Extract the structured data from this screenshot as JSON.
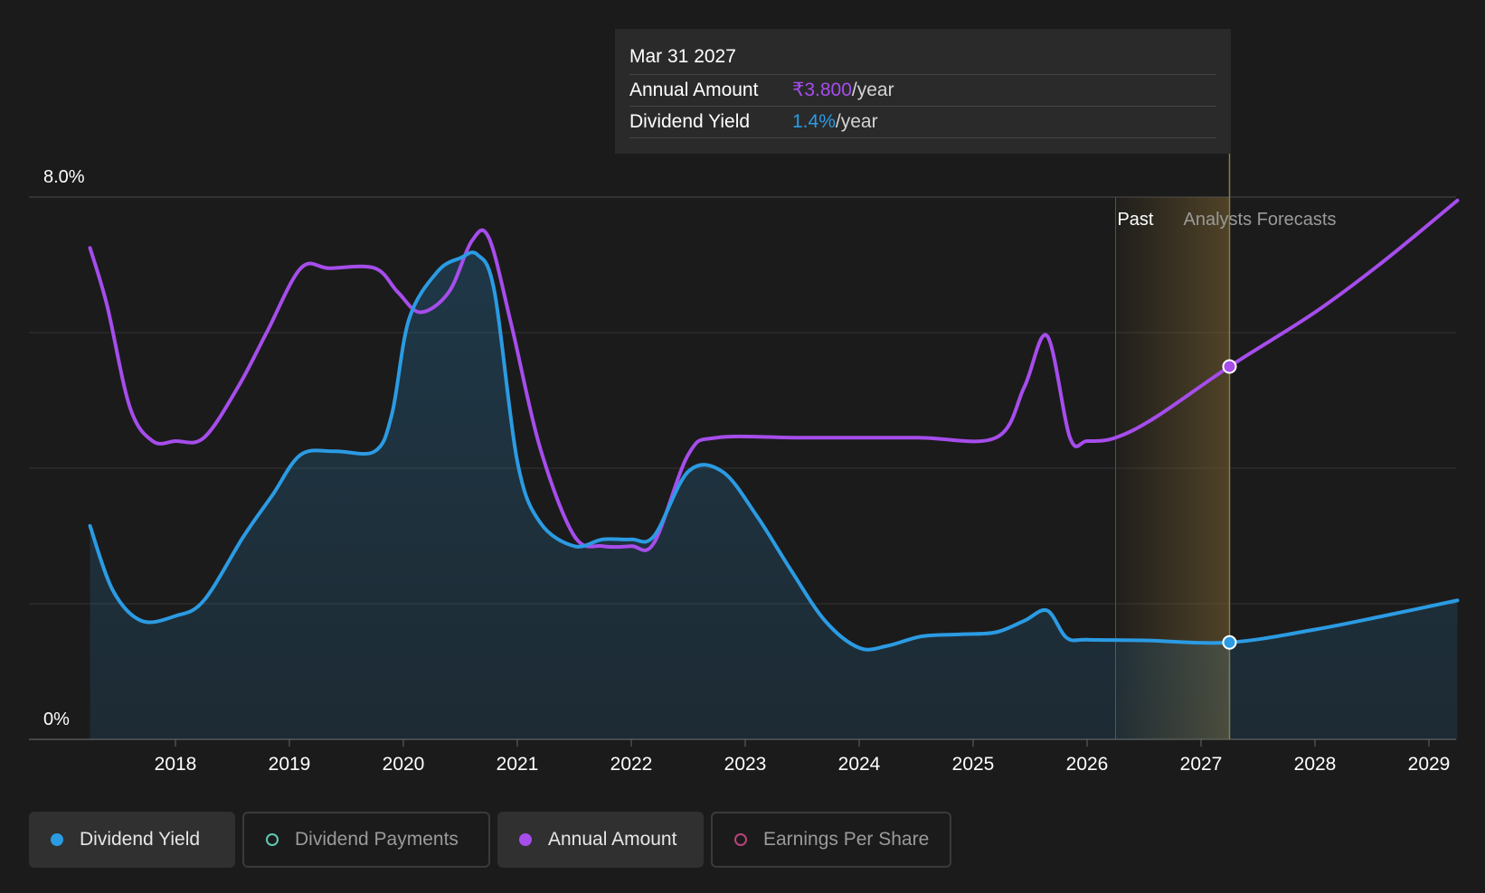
{
  "tooltip": {
    "date": "Mar 31 2027",
    "annual_amount_label": "Annual Amount",
    "annual_amount_value": "₹3.800",
    "annual_amount_unit": "/year",
    "dividend_yield_label": "Dividend Yield",
    "dividend_yield_value": "1.4%",
    "dividend_yield_unit": "/year"
  },
  "markers": {
    "past": "Past",
    "forecast": "Analysts Forecasts"
  },
  "legend": [
    {
      "label": "Dividend Yield",
      "color": "#2b9be3",
      "active": true,
      "filled": true
    },
    {
      "label": "Dividend Payments",
      "color": "#5fc9b5",
      "active": false,
      "filled": false
    },
    {
      "label": "Annual Amount",
      "color": "#a64dec",
      "active": true,
      "filled": true
    },
    {
      "label": "Earnings Per Share",
      "color": "#b8447a",
      "active": false,
      "filled": false
    }
  ],
  "colors": {
    "background": "#1b1b1b",
    "yield": "#2b9be3",
    "amount": "#a64dec",
    "forecast_band": "#7a6230"
  },
  "chart_data": {
    "type": "line",
    "ylim": [
      0,
      8.0
    ],
    "y_tick_labels": [
      "8.0%",
      "0%"
    ],
    "gridlines": [
      0,
      2,
      4,
      6,
      8
    ],
    "xlim": [
      2017.0,
      2029.25
    ],
    "x_tick_labels": [
      "2018",
      "2019",
      "2020",
      "2021",
      "2022",
      "2023",
      "2024",
      "2025",
      "2026",
      "2027",
      "2028",
      "2029"
    ],
    "past_start": 2026.25,
    "tooltip_x": 2027.25,
    "series": [
      {
        "name": "Dividend Yield",
        "area": true,
        "points": [
          [
            2017.25,
            3.15
          ],
          [
            2017.45,
            2.2
          ],
          [
            2017.7,
            1.75
          ],
          [
            2018.0,
            1.82
          ],
          [
            2018.25,
            2.05
          ],
          [
            2018.6,
            3.0
          ],
          [
            2018.85,
            3.6
          ],
          [
            2019.1,
            4.2
          ],
          [
            2019.4,
            4.25
          ],
          [
            2019.75,
            4.25
          ],
          [
            2019.9,
            4.8
          ],
          [
            2020.05,
            6.2
          ],
          [
            2020.3,
            6.9
          ],
          [
            2020.5,
            7.1
          ],
          [
            2020.65,
            7.15
          ],
          [
            2020.8,
            6.6
          ],
          [
            2021.0,
            4.1
          ],
          [
            2021.2,
            3.2
          ],
          [
            2021.5,
            2.85
          ],
          [
            2021.75,
            2.95
          ],
          [
            2022.0,
            2.95
          ],
          [
            2022.2,
            3.0
          ],
          [
            2022.5,
            3.95
          ],
          [
            2022.8,
            3.95
          ],
          [
            2023.1,
            3.3
          ],
          [
            2023.4,
            2.5
          ],
          [
            2023.7,
            1.75
          ],
          [
            2024.0,
            1.35
          ],
          [
            2024.25,
            1.38
          ],
          [
            2024.55,
            1.52
          ],
          [
            2024.9,
            1.55
          ],
          [
            2025.2,
            1.58
          ],
          [
            2025.45,
            1.75
          ],
          [
            2025.65,
            1.9
          ],
          [
            2025.82,
            1.5
          ],
          [
            2026.0,
            1.47
          ],
          [
            2026.5,
            1.46
          ],
          [
            2027.25,
            1.43
          ],
          [
            2028.0,
            1.62
          ],
          [
            2028.6,
            1.82
          ],
          [
            2029.25,
            2.05
          ]
        ]
      },
      {
        "name": "Annual Amount",
        "area": false,
        "points": [
          [
            2017.25,
            7.25
          ],
          [
            2017.4,
            6.4
          ],
          [
            2017.6,
            4.9
          ],
          [
            2017.8,
            4.4
          ],
          [
            2018.0,
            4.4
          ],
          [
            2018.25,
            4.45
          ],
          [
            2018.55,
            5.2
          ],
          [
            2018.8,
            6.0
          ],
          [
            2019.1,
            6.95
          ],
          [
            2019.35,
            6.95
          ],
          [
            2019.75,
            6.95
          ],
          [
            2019.95,
            6.6
          ],
          [
            2020.15,
            6.3
          ],
          [
            2020.4,
            6.6
          ],
          [
            2020.6,
            7.35
          ],
          [
            2020.75,
            7.4
          ],
          [
            2020.95,
            6.1
          ],
          [
            2021.2,
            4.3
          ],
          [
            2021.5,
            3.0
          ],
          [
            2021.75,
            2.85
          ],
          [
            2022.0,
            2.85
          ],
          [
            2022.2,
            2.9
          ],
          [
            2022.5,
            4.2
          ],
          [
            2022.75,
            4.45
          ],
          [
            2023.5,
            4.45
          ],
          [
            2024.5,
            4.45
          ],
          [
            2025.2,
            4.45
          ],
          [
            2025.45,
            5.2
          ],
          [
            2025.65,
            5.95
          ],
          [
            2025.85,
            4.45
          ],
          [
            2026.0,
            4.4
          ],
          [
            2026.25,
            4.45
          ],
          [
            2026.6,
            4.75
          ],
          [
            2027.25,
            5.5
          ],
          [
            2028.0,
            6.3
          ],
          [
            2028.6,
            7.05
          ],
          [
            2029.25,
            7.95
          ]
        ]
      }
    ]
  }
}
